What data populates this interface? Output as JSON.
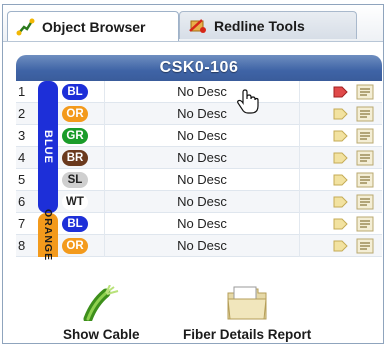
{
  "tabs": [
    {
      "label": "Object Browser",
      "icon": "object-browser-icon",
      "active": true
    },
    {
      "label": "Redline Tools",
      "icon": "redline-tools-icon",
      "active": false
    }
  ],
  "cable": {
    "title": "CSK0-106"
  },
  "groups": [
    {
      "label": "BLUE",
      "color": "#1d2fd8"
    },
    {
      "label": "ORANGE",
      "color": "#f39a1c"
    }
  ],
  "fibers": [
    {
      "num": "1",
      "code": "BL",
      "bg": "#1d2fd8",
      "fg": "#ffffff",
      "desc": "No Desc",
      "flag": "red-tag-icon"
    },
    {
      "num": "2",
      "code": "OR",
      "bg": "#f39a1c",
      "fg": "#ffffff",
      "desc": "No Desc",
      "flag": "tag-icon"
    },
    {
      "num": "3",
      "code": "GR",
      "bg": "#1a9c2a",
      "fg": "#ffffff",
      "desc": "No Desc",
      "flag": "tag-icon"
    },
    {
      "num": "4",
      "code": "BR",
      "bg": "#6b3a1e",
      "fg": "#ffffff",
      "desc": "No Desc",
      "flag": "tag-icon"
    },
    {
      "num": "5",
      "code": "SL",
      "bg": "#cfcfcf",
      "fg": "#222222",
      "desc": "No Desc",
      "flag": "tag-icon"
    },
    {
      "num": "6",
      "code": "WT",
      "bg": "#ffffff",
      "fg": "#222222",
      "desc": "No Desc",
      "flag": "tag-icon"
    },
    {
      "num": "7",
      "code": "BL",
      "bg": "#1d2fd8",
      "fg": "#ffffff",
      "desc": "No Desc",
      "flag": "tag-icon"
    },
    {
      "num": "8",
      "code": "OR",
      "bg": "#f39a1c",
      "fg": "#ffffff",
      "desc": "No Desc",
      "flag": "tag-icon"
    }
  ],
  "footer": {
    "show_cable_label": "Show Cable",
    "fiber_report_label": "Fiber Details Report"
  }
}
